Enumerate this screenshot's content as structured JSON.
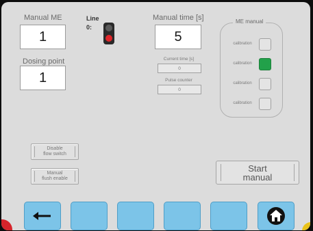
{
  "manual_me": {
    "label": "Manual ME",
    "value": "1"
  },
  "line": {
    "label": "Line",
    "number": "0:"
  },
  "manual_time": {
    "label": "Manual time [s]",
    "value": "5"
  },
  "dosing_point": {
    "label": "Dosing point",
    "value": "1"
  },
  "current_time": {
    "label": "Current time [s]",
    "value": "0"
  },
  "pulse_counter": {
    "label": "Pulse counter",
    "value": "0"
  },
  "me_manual": {
    "title": "ME manual",
    "rows": [
      {
        "label": "calibration",
        "active": false
      },
      {
        "label": "calibration",
        "active": true
      },
      {
        "label": "calibration",
        "active": false
      },
      {
        "label": "calibration",
        "active": false
      }
    ]
  },
  "buttons": {
    "disable_flow_switch": {
      "line1": "Disable",
      "line2": "flow switch"
    },
    "manual_flush_enable": {
      "line1": "Manual",
      "line2": "flush enable"
    },
    "start_manual": {
      "line1": "Start",
      "line2": "manual"
    }
  },
  "colors": {
    "panel": "#dcdcdc",
    "nav_button": "#7cc4e8",
    "active_indicator": "#22a14a",
    "red_light": "#e0262a"
  },
  "nav": [
    "back-arrow-icon",
    "blank",
    "blank",
    "blank",
    "blank",
    "blank",
    "home-icon"
  ]
}
